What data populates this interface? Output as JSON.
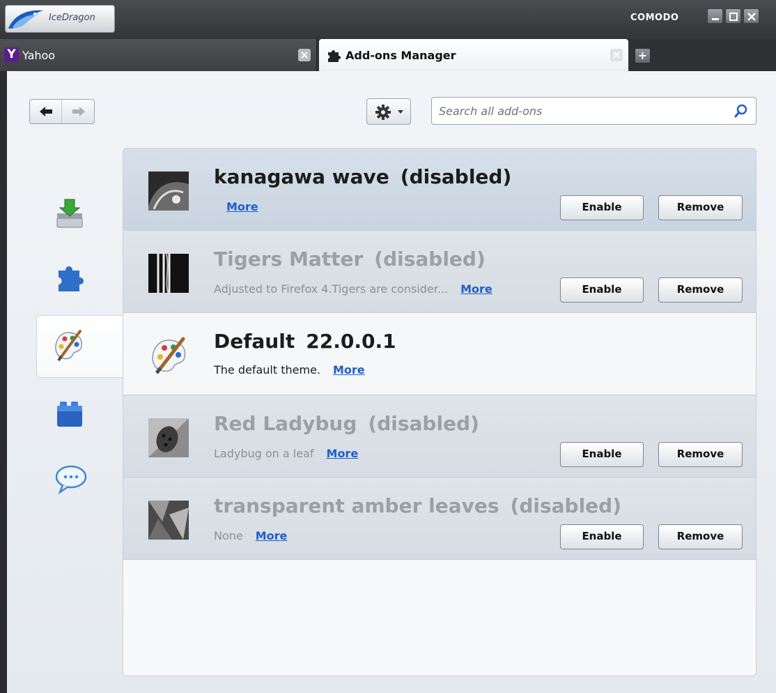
{
  "app": {
    "name": "IceDragon",
    "brand": "COMODO"
  },
  "tabs": [
    {
      "label": "Yahoo",
      "icon": "yahoo-icon"
    },
    {
      "label": "Add-ons Manager",
      "icon": "puzzle-icon"
    }
  ],
  "toolbar": {
    "search_placeholder": "Search all add-ons"
  },
  "sidebar": {
    "categories": [
      {
        "name": "get-addons",
        "icon": "download-icon"
      },
      {
        "name": "extensions",
        "icon": "puzzle-icon"
      },
      {
        "name": "appearance",
        "icon": "palette-icon",
        "selected": true
      },
      {
        "name": "plugins",
        "icon": "lego-block-icon"
      },
      {
        "name": "services",
        "icon": "chat-bubble-icon"
      }
    ]
  },
  "addons": [
    {
      "name": "kanagawa wave",
      "status": "(disabled)",
      "description": "",
      "more": "More",
      "enable": "Enable",
      "remove": "Remove"
    },
    {
      "name": "Tigers Matter",
      "status": "(disabled)",
      "description": "Adjusted to Firefox 4.Tigers are consider...",
      "more": "More",
      "enable": "Enable",
      "remove": "Remove"
    },
    {
      "name": "Default",
      "status": "22.0.0.1",
      "description": "The default theme.",
      "more": "More"
    },
    {
      "name": "Red Ladybug",
      "status": "(disabled)",
      "description": "Ladybug on a leaf",
      "more": "More",
      "enable": "Enable",
      "remove": "Remove"
    },
    {
      "name": "transparent amber leaves",
      "status": "(disabled)",
      "description": "None",
      "more": "More",
      "enable": "Enable",
      "remove": "Remove"
    }
  ],
  "colors": {
    "link": "#1f5fc9",
    "titlebar": "#3d3f42",
    "yahoo": "#5c1e8d"
  }
}
